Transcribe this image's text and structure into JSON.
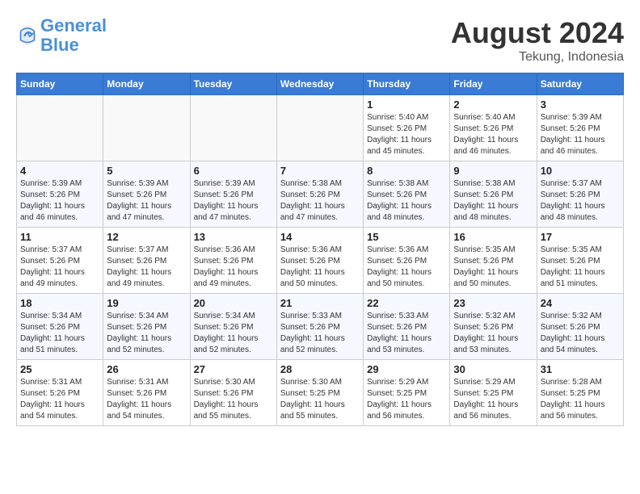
{
  "logo": {
    "line1": "General",
    "line2": "Blue"
  },
  "title": "August 2024",
  "location": "Tekung, Indonesia",
  "days_of_week": [
    "Sunday",
    "Monday",
    "Tuesday",
    "Wednesday",
    "Thursday",
    "Friday",
    "Saturday"
  ],
  "weeks": [
    [
      {
        "day": "",
        "info": ""
      },
      {
        "day": "",
        "info": ""
      },
      {
        "day": "",
        "info": ""
      },
      {
        "day": "",
        "info": ""
      },
      {
        "day": "1",
        "info": "Sunrise: 5:40 AM\nSunset: 5:26 PM\nDaylight: 11 hours\nand 45 minutes."
      },
      {
        "day": "2",
        "info": "Sunrise: 5:40 AM\nSunset: 5:26 PM\nDaylight: 11 hours\nand 46 minutes."
      },
      {
        "day": "3",
        "info": "Sunrise: 5:39 AM\nSunset: 5:26 PM\nDaylight: 11 hours\nand 46 minutes."
      }
    ],
    [
      {
        "day": "4",
        "info": "Sunrise: 5:39 AM\nSunset: 5:26 PM\nDaylight: 11 hours\nand 46 minutes."
      },
      {
        "day": "5",
        "info": "Sunrise: 5:39 AM\nSunset: 5:26 PM\nDaylight: 11 hours\nand 47 minutes."
      },
      {
        "day": "6",
        "info": "Sunrise: 5:39 AM\nSunset: 5:26 PM\nDaylight: 11 hours\nand 47 minutes."
      },
      {
        "day": "7",
        "info": "Sunrise: 5:38 AM\nSunset: 5:26 PM\nDaylight: 11 hours\nand 47 minutes."
      },
      {
        "day": "8",
        "info": "Sunrise: 5:38 AM\nSunset: 5:26 PM\nDaylight: 11 hours\nand 48 minutes."
      },
      {
        "day": "9",
        "info": "Sunrise: 5:38 AM\nSunset: 5:26 PM\nDaylight: 11 hours\nand 48 minutes."
      },
      {
        "day": "10",
        "info": "Sunrise: 5:37 AM\nSunset: 5:26 PM\nDaylight: 11 hours\nand 48 minutes."
      }
    ],
    [
      {
        "day": "11",
        "info": "Sunrise: 5:37 AM\nSunset: 5:26 PM\nDaylight: 11 hours\nand 49 minutes."
      },
      {
        "day": "12",
        "info": "Sunrise: 5:37 AM\nSunset: 5:26 PM\nDaylight: 11 hours\nand 49 minutes."
      },
      {
        "day": "13",
        "info": "Sunrise: 5:36 AM\nSunset: 5:26 PM\nDaylight: 11 hours\nand 49 minutes."
      },
      {
        "day": "14",
        "info": "Sunrise: 5:36 AM\nSunset: 5:26 PM\nDaylight: 11 hours\nand 50 minutes."
      },
      {
        "day": "15",
        "info": "Sunrise: 5:36 AM\nSunset: 5:26 PM\nDaylight: 11 hours\nand 50 minutes."
      },
      {
        "day": "16",
        "info": "Sunrise: 5:35 AM\nSunset: 5:26 PM\nDaylight: 11 hours\nand 50 minutes."
      },
      {
        "day": "17",
        "info": "Sunrise: 5:35 AM\nSunset: 5:26 PM\nDaylight: 11 hours\nand 51 minutes."
      }
    ],
    [
      {
        "day": "18",
        "info": "Sunrise: 5:34 AM\nSunset: 5:26 PM\nDaylight: 11 hours\nand 51 minutes."
      },
      {
        "day": "19",
        "info": "Sunrise: 5:34 AM\nSunset: 5:26 PM\nDaylight: 11 hours\nand 52 minutes."
      },
      {
        "day": "20",
        "info": "Sunrise: 5:34 AM\nSunset: 5:26 PM\nDaylight: 11 hours\nand 52 minutes."
      },
      {
        "day": "21",
        "info": "Sunrise: 5:33 AM\nSunset: 5:26 PM\nDaylight: 11 hours\nand 52 minutes."
      },
      {
        "day": "22",
        "info": "Sunrise: 5:33 AM\nSunset: 5:26 PM\nDaylight: 11 hours\nand 53 minutes."
      },
      {
        "day": "23",
        "info": "Sunrise: 5:32 AM\nSunset: 5:26 PM\nDaylight: 11 hours\nand 53 minutes."
      },
      {
        "day": "24",
        "info": "Sunrise: 5:32 AM\nSunset: 5:26 PM\nDaylight: 11 hours\nand 54 minutes."
      }
    ],
    [
      {
        "day": "25",
        "info": "Sunrise: 5:31 AM\nSunset: 5:26 PM\nDaylight: 11 hours\nand 54 minutes."
      },
      {
        "day": "26",
        "info": "Sunrise: 5:31 AM\nSunset: 5:26 PM\nDaylight: 11 hours\nand 54 minutes."
      },
      {
        "day": "27",
        "info": "Sunrise: 5:30 AM\nSunset: 5:26 PM\nDaylight: 11 hours\nand 55 minutes."
      },
      {
        "day": "28",
        "info": "Sunrise: 5:30 AM\nSunset: 5:25 PM\nDaylight: 11 hours\nand 55 minutes."
      },
      {
        "day": "29",
        "info": "Sunrise: 5:29 AM\nSunset: 5:25 PM\nDaylight: 11 hours\nand 56 minutes."
      },
      {
        "day": "30",
        "info": "Sunrise: 5:29 AM\nSunset: 5:25 PM\nDaylight: 11 hours\nand 56 minutes."
      },
      {
        "day": "31",
        "info": "Sunrise: 5:28 AM\nSunset: 5:25 PM\nDaylight: 11 hours\nand 56 minutes."
      }
    ]
  ]
}
